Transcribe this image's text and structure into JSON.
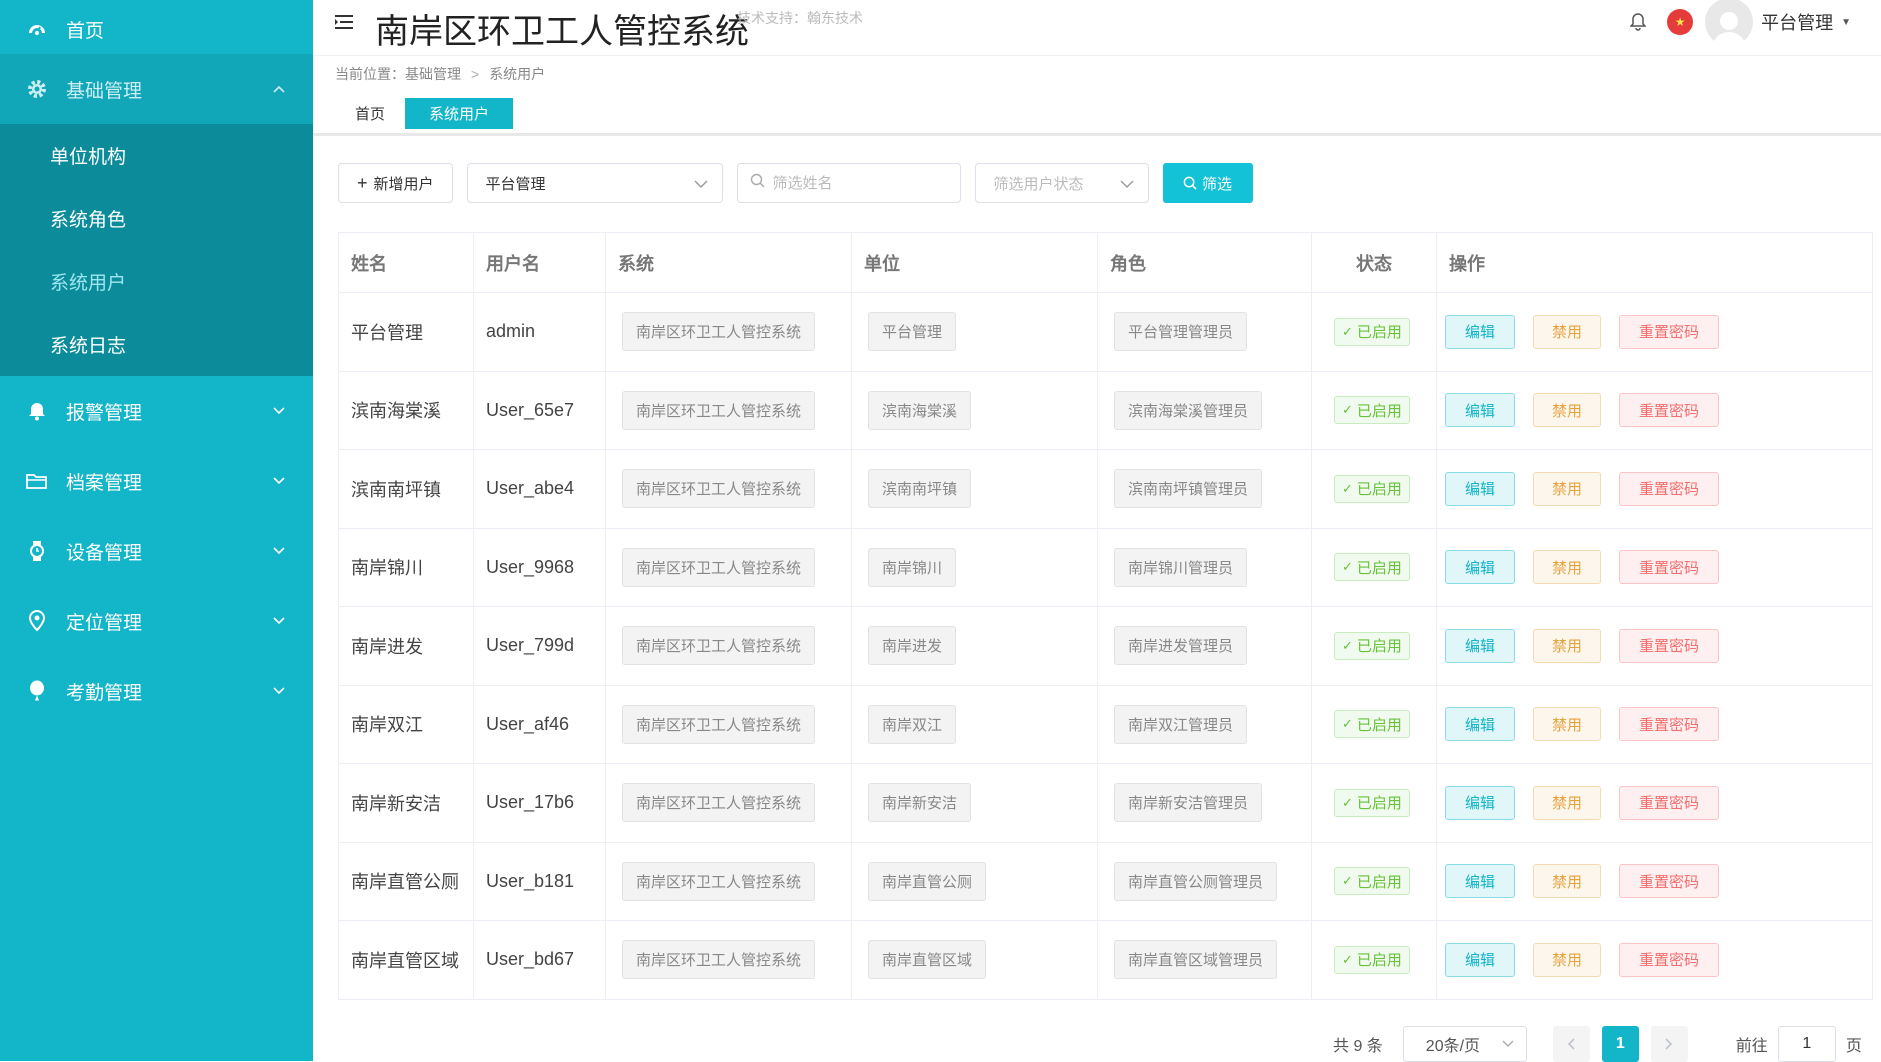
{
  "sidebar": {
    "home": "首页",
    "groups": [
      {
        "label": "基础管理",
        "icon": "gear-icon"
      },
      {
        "label": "报警管理",
        "icon": "bell-icon"
      },
      {
        "label": "档案管理",
        "icon": "folder-icon"
      },
      {
        "label": "设备管理",
        "icon": "watch-icon"
      },
      {
        "label": "定位管理",
        "icon": "location-icon"
      },
      {
        "label": "考勤管理",
        "icon": "balloon-icon"
      }
    ],
    "sub_items": [
      "单位机构",
      "系统角色",
      "系统用户",
      "系统日志"
    ],
    "active_sub": "系统用户"
  },
  "header": {
    "title": "南岸区环卫工人管控系统",
    "tech_support": "技术支持：翰东技术",
    "user_name": "平台管理"
  },
  "breadcrumb": {
    "prefix": "当前位置：",
    "items": [
      "基础管理",
      "系统用户"
    ]
  },
  "tabs": [
    "首页",
    "系统用户"
  ],
  "toolbar": {
    "add_label": "新增用户",
    "system_select": "平台管理",
    "name_placeholder": "筛选姓名",
    "status_placeholder": "筛选用户状态",
    "filter_label": "筛选"
  },
  "table": {
    "columns": [
      "姓名",
      "用户名",
      "系统",
      "单位",
      "角色",
      "状态",
      "操作"
    ],
    "actions": {
      "edit": "编辑",
      "disable": "禁用",
      "reset": "重置密码"
    },
    "rows": [
      {
        "name": "平台管理",
        "username": "admin",
        "system": "南岸区环卫工人管控系统",
        "unit": "平台管理",
        "role": "平台管理管理员",
        "status": "已启用"
      },
      {
        "name": "滨南海棠溪",
        "username": "User_65e7",
        "system": "南岸区环卫工人管控系统",
        "unit": "滨南海棠溪",
        "role": "滨南海棠溪管理员",
        "status": "已启用"
      },
      {
        "name": "滨南南坪镇",
        "username": "User_abe4",
        "system": "南岸区环卫工人管控系统",
        "unit": "滨南南坪镇",
        "role": "滨南南坪镇管理员",
        "status": "已启用"
      },
      {
        "name": "南岸锦川",
        "username": "User_9968",
        "system": "南岸区环卫工人管控系统",
        "unit": "南岸锦川",
        "role": "南岸锦川管理员",
        "status": "已启用"
      },
      {
        "name": "南岸进发",
        "username": "User_799d",
        "system": "南岸区环卫工人管控系统",
        "unit": "南岸进发",
        "role": "南岸进发管理员",
        "status": "已启用"
      },
      {
        "name": "南岸双江",
        "username": "User_af46",
        "system": "南岸区环卫工人管控系统",
        "unit": "南岸双江",
        "role": "南岸双江管理员",
        "status": "已启用"
      },
      {
        "name": "南岸新安洁",
        "username": "User_17b6",
        "system": "南岸区环卫工人管控系统",
        "unit": "南岸新安洁",
        "role": "南岸新安洁管理员",
        "status": "已启用"
      },
      {
        "name": "南岸直管公厕",
        "username": "User_b181",
        "system": "南岸区环卫工人管控系统",
        "unit": "南岸直管公厕",
        "role": "南岸直管公厕管理员",
        "status": "已启用"
      },
      {
        "name": "南岸直管区域",
        "username": "User_bd67",
        "system": "南岸区环卫工人管控系统",
        "unit": "南岸直管区域",
        "role": "南岸直管区域管理员",
        "status": "已启用"
      }
    ]
  },
  "pagination": {
    "total": "共 9 条",
    "page_size": "20条/页",
    "current_page": "1",
    "goto_prefix": "前往",
    "goto_value": "1",
    "goto_suffix": "页"
  },
  "colors": {
    "sidebar": "#13b5c8",
    "submenu": "#0c8c9a",
    "accent": "#13c2d6",
    "success": "#67c23a",
    "warning": "#e6a23c",
    "danger": "#f56c6c"
  }
}
